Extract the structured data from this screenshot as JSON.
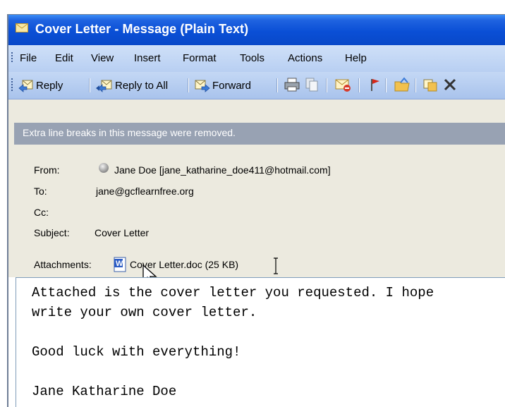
{
  "window": {
    "title": "Cover Letter - Message (Plain Text)"
  },
  "menu": {
    "items": [
      "File",
      "Edit",
      "View",
      "Insert",
      "Format",
      "Tools",
      "Actions",
      "Help"
    ]
  },
  "toolbar": {
    "reply_label": "Reply",
    "reply_all_label": "Reply to All",
    "forward_label": "Forward"
  },
  "infobar": {
    "text": "Extra line breaks in this message were removed."
  },
  "header": {
    "from_label": "From:",
    "from_value": "Jane Doe [jane_katharine_doe411@hotmail.com]",
    "to_label": "To:",
    "to_value": "jane@gcflearnfree.org",
    "cc_label": "Cc:",
    "cc_value": "",
    "subject_label": "Subject:",
    "subject_value": "Cover Letter",
    "attachments_label": "Attachments:",
    "attachment_name": "Cover Letter.doc (25 KB)"
  },
  "body": {
    "lines": [
      "Attached is the cover letter you requested. I hope",
      "write your own cover letter.",
      "",
      "Good luck with everything!",
      "",
      "Jane Katharine Doe"
    ]
  },
  "colors": {
    "titlebar": "#0a4fd6",
    "menubar": "#c4d8f5",
    "infobar": "#98a2b3",
    "header_bg": "#eceadf"
  },
  "icons": {
    "title": "envelope-icon",
    "attachment": "word-document-icon",
    "presence": "presence-status-icon"
  }
}
